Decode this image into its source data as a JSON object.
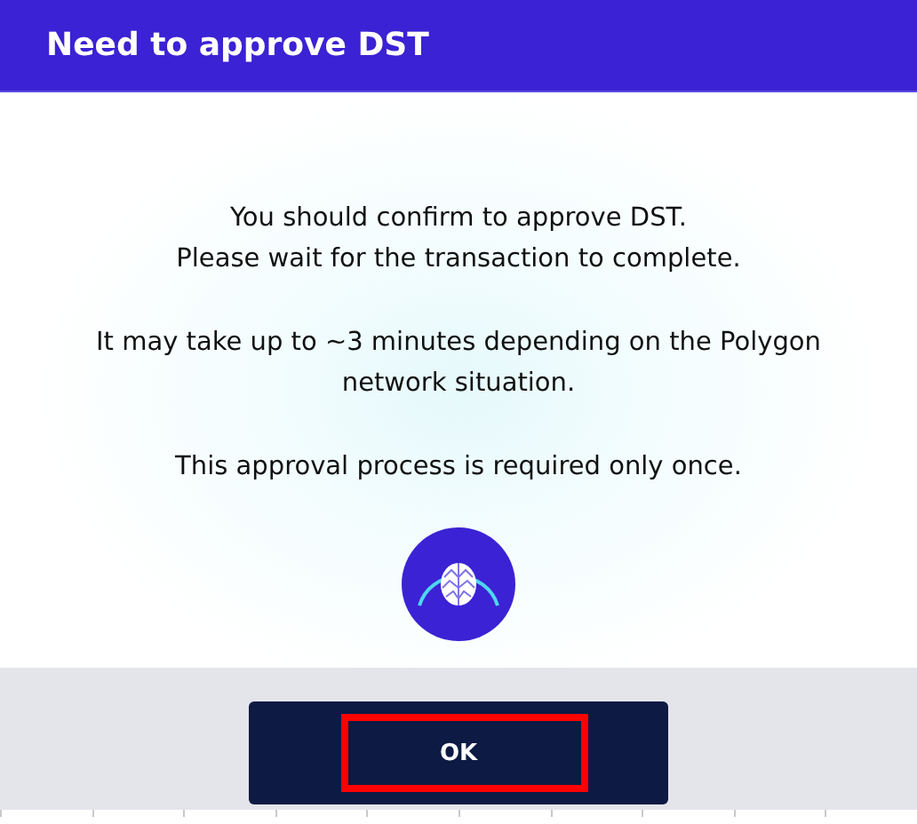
{
  "dialog": {
    "title": "Need to approve DST",
    "paragraphs": [
      {
        "lines": [
          "You should confirm to approve DST.",
          "Please wait for the transaction to complete."
        ]
      },
      {
        "lines": [
          "It may take up to ~3 minutes depending on the Polygon",
          "network situation."
        ]
      },
      {
        "lines": [
          "This approval process is required only once."
        ]
      }
    ],
    "buttons": [
      {
        "label": "OK",
        "highlighted": true
      }
    ]
  }
}
